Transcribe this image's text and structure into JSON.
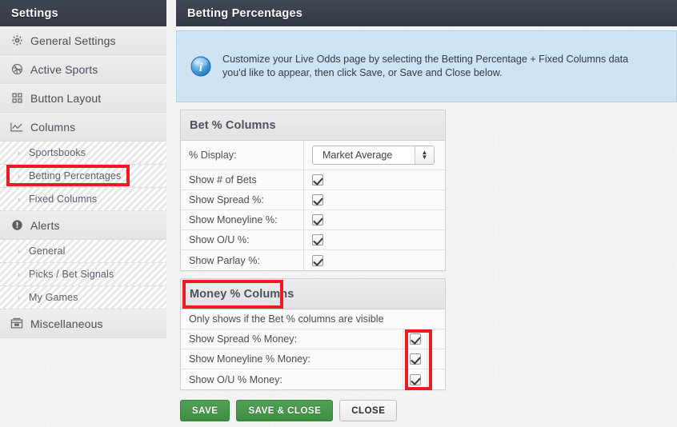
{
  "sidebar": {
    "title": "Settings",
    "items": [
      {
        "label": "General Settings",
        "icon": "gear-icon",
        "level": "primary",
        "key": "general-settings"
      },
      {
        "label": "Active Sports",
        "icon": "ball-icon",
        "level": "primary",
        "key": "active-sports"
      },
      {
        "label": "Button Layout",
        "icon": "grid-icon",
        "level": "primary",
        "key": "button-layout"
      },
      {
        "label": "Columns",
        "icon": "chart-icon",
        "level": "primary",
        "key": "columns"
      },
      {
        "label": "Sportsbooks",
        "icon": "bullet-icon",
        "level": "sub",
        "key": "sportsbooks"
      },
      {
        "label": "Betting Percentages",
        "icon": "bullet-icon",
        "level": "sub",
        "key": "betting-percentages",
        "highlighted": true
      },
      {
        "label": "Fixed Columns",
        "icon": "bullet-icon",
        "level": "sub",
        "key": "fixed-columns"
      },
      {
        "label": "Alerts",
        "icon": "alert-icon",
        "level": "primary",
        "key": "alerts"
      },
      {
        "label": "General",
        "icon": "bullet-icon",
        "level": "sub",
        "key": "alerts-general"
      },
      {
        "label": "Picks / Bet Signals",
        "icon": "bullet-icon",
        "level": "sub",
        "key": "picks-bet-signals"
      },
      {
        "label": "My Games",
        "icon": "bullet-icon",
        "level": "sub",
        "key": "my-games"
      },
      {
        "label": "Miscellaneous",
        "icon": "box-icon",
        "level": "primary",
        "key": "miscellaneous"
      }
    ]
  },
  "main": {
    "header_title": "Betting Percentages",
    "info": {
      "icon": "info-icon",
      "text": "Customize your Live Odds page by selecting the Betting Percentage + Fixed Columns data you'd like to appear, then click Save, or Save and Close below."
    },
    "bet_panel": {
      "title": "Bet % Columns",
      "display_row": {
        "label": "% Display:",
        "selected": "Market Average"
      },
      "rows": [
        {
          "label": "Show # of Bets",
          "checked": true
        },
        {
          "label": "Show Spread %:",
          "checked": true
        },
        {
          "label": "Show Moneyline %:",
          "checked": true
        },
        {
          "label": "Show O/U %:",
          "checked": true
        },
        {
          "label": "Show Parlay %:",
          "checked": true
        }
      ]
    },
    "money_panel": {
      "title": "Money % Columns",
      "note": "Only shows if the Bet % columns are visible",
      "rows": [
        {
          "label": "Show Spread % Money:",
          "checked": true
        },
        {
          "label": "Show Moneyline % Money:",
          "checked": true
        },
        {
          "label": "Show O/U % Money:",
          "checked": true
        }
      ]
    },
    "buttons": [
      {
        "label": "SAVE",
        "style": "green",
        "key": "save"
      },
      {
        "label": "SAVE & CLOSE",
        "style": "green",
        "key": "save-and-close"
      },
      {
        "label": "CLOSE",
        "style": "grey",
        "key": "close"
      }
    ]
  },
  "annotations": {
    "color": "#ee1c22",
    "boxes": [
      "sidebar-betting-percentages",
      "money-percent-columns-title",
      "money-percent-checkboxes"
    ]
  }
}
